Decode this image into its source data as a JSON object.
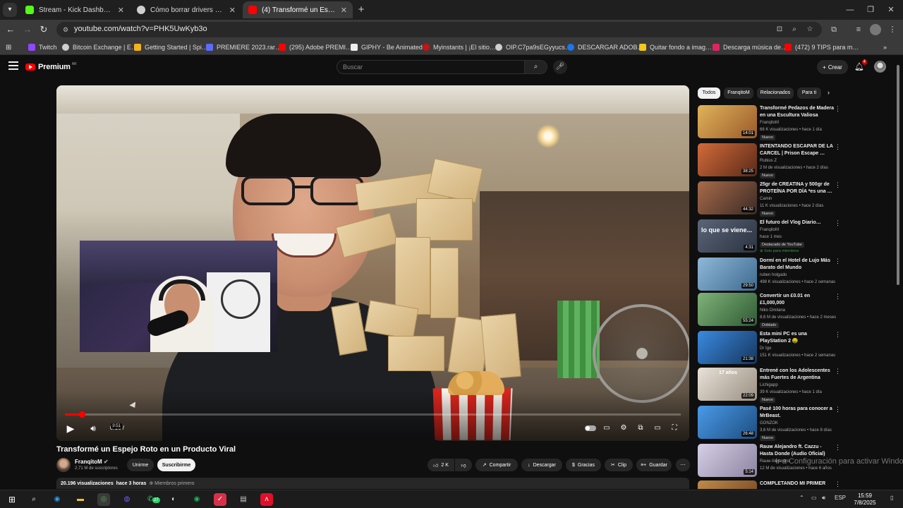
{
  "browser": {
    "tabs": [
      {
        "title": "Stream - Kick Dashboard",
        "favicon_color": "#53fc18",
        "active": false
      },
      {
        "title": "Cómo borrar drivers de mi grafi…",
        "favicon_color": "#cfcfcf",
        "active": false
      },
      {
        "title": "(4) Transformé un Espejo Roto e…",
        "favicon_color": "#ff0000",
        "active": true
      }
    ],
    "url": "youtube.com/watch?v=PHK5UwKyb3o",
    "bookmarks": [
      {
        "label": "Twitch",
        "color": "#9146ff"
      },
      {
        "label": "Bitcoin Exchange | E…",
        "color": "#cfcfcf"
      },
      {
        "label": "Getting Started | Spi…",
        "color": "#f5b21a"
      },
      {
        "label": "PREMIERE 2023.rar…",
        "color": "#5b6cff"
      },
      {
        "label": "(295) Adobe PREMI…",
        "color": "#ff0000"
      },
      {
        "label": "GIPHY - Be Animated",
        "color": "#eeeeee"
      },
      {
        "label": "Myinstants | ¡El sitio…",
        "color": "#cc1111"
      },
      {
        "label": "OIP.C7pa9sEGyyucs…",
        "color": "#cfcfcf"
      },
      {
        "label": "DESCARGAR ADOB…",
        "color": "#1877f2"
      },
      {
        "label": "Quitar fondo a imag…",
        "color": "#f5c518"
      },
      {
        "label": "Descarga música de…",
        "color": "#e0245e"
      },
      {
        "label": "(472) 9 TIPS para m…",
        "color": "#ff0000"
      }
    ]
  },
  "youtube": {
    "logo_text": "Premium",
    "logo_cc": "AR",
    "search_placeholder": "Buscar",
    "create_label": "Crear",
    "notif_count": "4"
  },
  "player": {
    "current_time": "0:16",
    "duration": "9:51",
    "progress": 0.027
  },
  "video": {
    "title": "Transformé un Espejo Roto en un Producto Viral",
    "channel": "FranqitoM",
    "subscribers": "2,71 M de suscriptores",
    "join_label": "Unirme",
    "subscribe_label": "Suscribirme",
    "likes": "2 K",
    "share_label": "Compartir",
    "download_label": "Descargar",
    "thanks_label": "Gracias",
    "clip_label": "Clip",
    "save_label": "Guardar",
    "views": "20.196 visualizaciones",
    "published": "hace 3 horas",
    "members": "Miembros primero"
  },
  "sidebar": {
    "chips": [
      "Todos",
      "FranqitoM",
      "Relacionados",
      "Para ti"
    ],
    "items": [
      {
        "title": "Transformé Pedazos de Madera en una Escultura Valiosa",
        "channel": "FranqitoM",
        "meta": "68 K visualizaciones • hace 1 día",
        "badge": "Nuevo",
        "duration": "14:01",
        "thumb_color": "#c98a3a"
      },
      {
        "title": "INTENTANDO ESCAPAR DE LA CARCEL | Prison Escape …",
        "channel": "Rubius Z",
        "meta": "2 M de visualizaciones • hace 2 días",
        "badge": "Nuevo",
        "duration": "38:25",
        "thumb_color": "#a8512c"
      },
      {
        "title": "25gr de CREATINA y 500gr de PROTEÍNA POR DÍA *es una …",
        "channel": "Camin",
        "meta": "11 K visualizaciones • hace 2 días",
        "badge": "Nuevo",
        "duration": "44:32",
        "thumb_color": "#6b4a3c"
      },
      {
        "title": "El futuro del Vlog Diario…",
        "channel": "FranqitoM",
        "meta": "hace 1 mes",
        "badge": "Destacado de YouTube",
        "badge2": "Solo para miembros",
        "duration": "4:31",
        "thumb_color": "#4a5568",
        "thumb_text": "lo que se viene..."
      },
      {
        "title": "Dormí en el Hotel de Lujo Más Barato del Mundo",
        "channel": "ruben holgado",
        "meta": "498 K visualizaciones • hace 2 semanas",
        "duration": "29:50",
        "thumb_color": "#5f8fb8"
      },
      {
        "title": "Convertir un £0.01 en £1,000,000",
        "channel": "Niko Omilana",
        "meta": "8,6 M de visualizaciones • hace 2 meses",
        "badge": "Doblado",
        "duration": "55:24",
        "thumb_color": "#3f7a4a"
      },
      {
        "title": "Esta mini PC es una PlayStation 2 🤑",
        "channel": "Dr Igo",
        "meta": "151 K visualizaciones • hace 2 semanas",
        "duration": "21:38",
        "thumb_color": "#2d6db3"
      },
      {
        "title": "Entrené con los Adolescentes más Fuertes de Argentina",
        "channel": "Lichigapp",
        "meta": "39 K visualizaciones • hace 1 día",
        "badge": "Nuevo",
        "duration": "22:09",
        "thumb_color": "#c9c2b8",
        "thumb_text": "17 años"
      },
      {
        "title": "Pasé 100 horas para conocer a MrBeast.",
        "channel": "GONZOK",
        "meta": "3,6 M de visualizaciones • hace 8 días",
        "badge": "Nuevo",
        "duration": "26:48",
        "thumb_color": "#3b7fc4"
      },
      {
        "title": "Rauw Alejandro ft. Cazzu - Hasta Donde (Audio Oficial)",
        "channel": "Rauw Alejandro",
        "meta": "12 M de visualizaciones • hace 6 años",
        "duration": "5:14",
        "thumb_color": "#b9b2c9"
      },
      {
        "title": "COMPLETANDO MI PRIMER",
        "channel": "",
        "meta": "",
        "duration": "",
        "thumb_color": "#9a6a3a"
      }
    ]
  },
  "watermark": "Ir a Configuración para activar Windows.",
  "taskbar": {
    "lang": "ESP",
    "time": "15:59",
    "date": "7/8/2025",
    "whatsapp_count": "27"
  }
}
